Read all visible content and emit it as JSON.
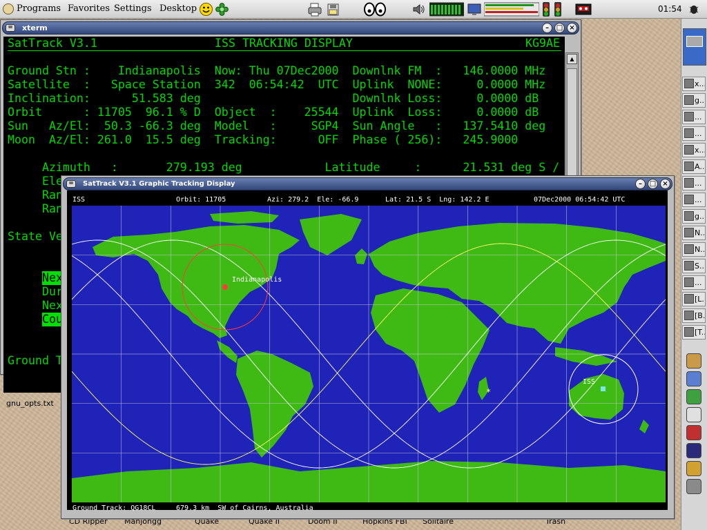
{
  "panel": {
    "menus": [
      "Programs",
      "Favorites",
      "Settings",
      "Desktop"
    ],
    "clock": "01:54"
  },
  "desktop": {
    "icons": [
      {
        "label": "gnu_opts.txt"
      }
    ],
    "hidden_labels": [
      "CD Ripper",
      "Mahjongg",
      "Quake",
      "Quake II",
      "Doom II",
      "Hopkins FBI",
      "Solitaire",
      "Trash"
    ]
  },
  "tasklist": {
    "items": [
      "x...",
      "g...",
      "...",
      "...",
      "x...",
      "A...",
      "...",
      "...",
      "g...",
      "N...",
      "N...",
      "S...",
      "...",
      "[L...",
      "[B...",
      "[T..."
    ]
  },
  "xterm": {
    "title": "xterm",
    "header_left": "SatTrack V3.1",
    "header_center": "ISS TRACKING DISPLAY",
    "header_right": "KG9AE",
    "rows": [
      "Ground Stn :    Indianapolis  Now: Thu 07Dec2000  Downlnk FM  :   146.0000 MHz",
      "Satellite  :   Space Station  342  06:54:42  UTC  Uplink  NONE:     0.0000 MHz",
      "Inclination:      51.583 deg                      Downlnk Loss:     0.0000 dB",
      "Orbit      : 11705  96.1 % D  Object  :    25544  Uplink  Loss:     0.0000 dB",
      "Sun   Az/El:  50.3 -66.3 deg  Model   :     SGP4  Sun Angle   :   137.5410 deg",
      "Moon  Az/El: 261.0  15.5 deg  Tracking:      OFF  Phase ( 256):   245.9000"
    ],
    "az_line": "     Azimuth   :       279.193 deg            Latitude     :      21.531 deg S /",
    "partial_labels": [
      "Ele",
      "Ran",
      "Ran"
    ],
    "state_label": "State Ve",
    "hl_labels": [
      "Nex",
      "Cou"
    ],
    "plain_labels": [
      "Dur",
      "Nex"
    ],
    "ground_label": "Ground T"
  },
  "sattrack": {
    "title": "SatTrack V3.1  Graphic Tracking Display",
    "status": {
      "sat": "ISS",
      "orbit": "Orbit: 11705",
      "azel": "Azi: 279.2  Ele: -66.9",
      "latlng": "Lat: 21.5 S  Lng: 142.2 E",
      "datetime": "07Dec2000 06:54:42 UTC"
    },
    "ground_station_label": "Indianapolis",
    "sat_label": "ISS",
    "footer": {
      "grid": "Ground Track: QG18CL",
      "dist": "679.3 km  SW of Cairns, Australia"
    },
    "colors": {
      "ocean": "#1f23b8",
      "land": "#3fba15",
      "grid": "#c8c8d8",
      "track": "#ffffff",
      "ground_station_circle": "#ff3b3b",
      "sat_marker": "#7ee6e6"
    }
  }
}
